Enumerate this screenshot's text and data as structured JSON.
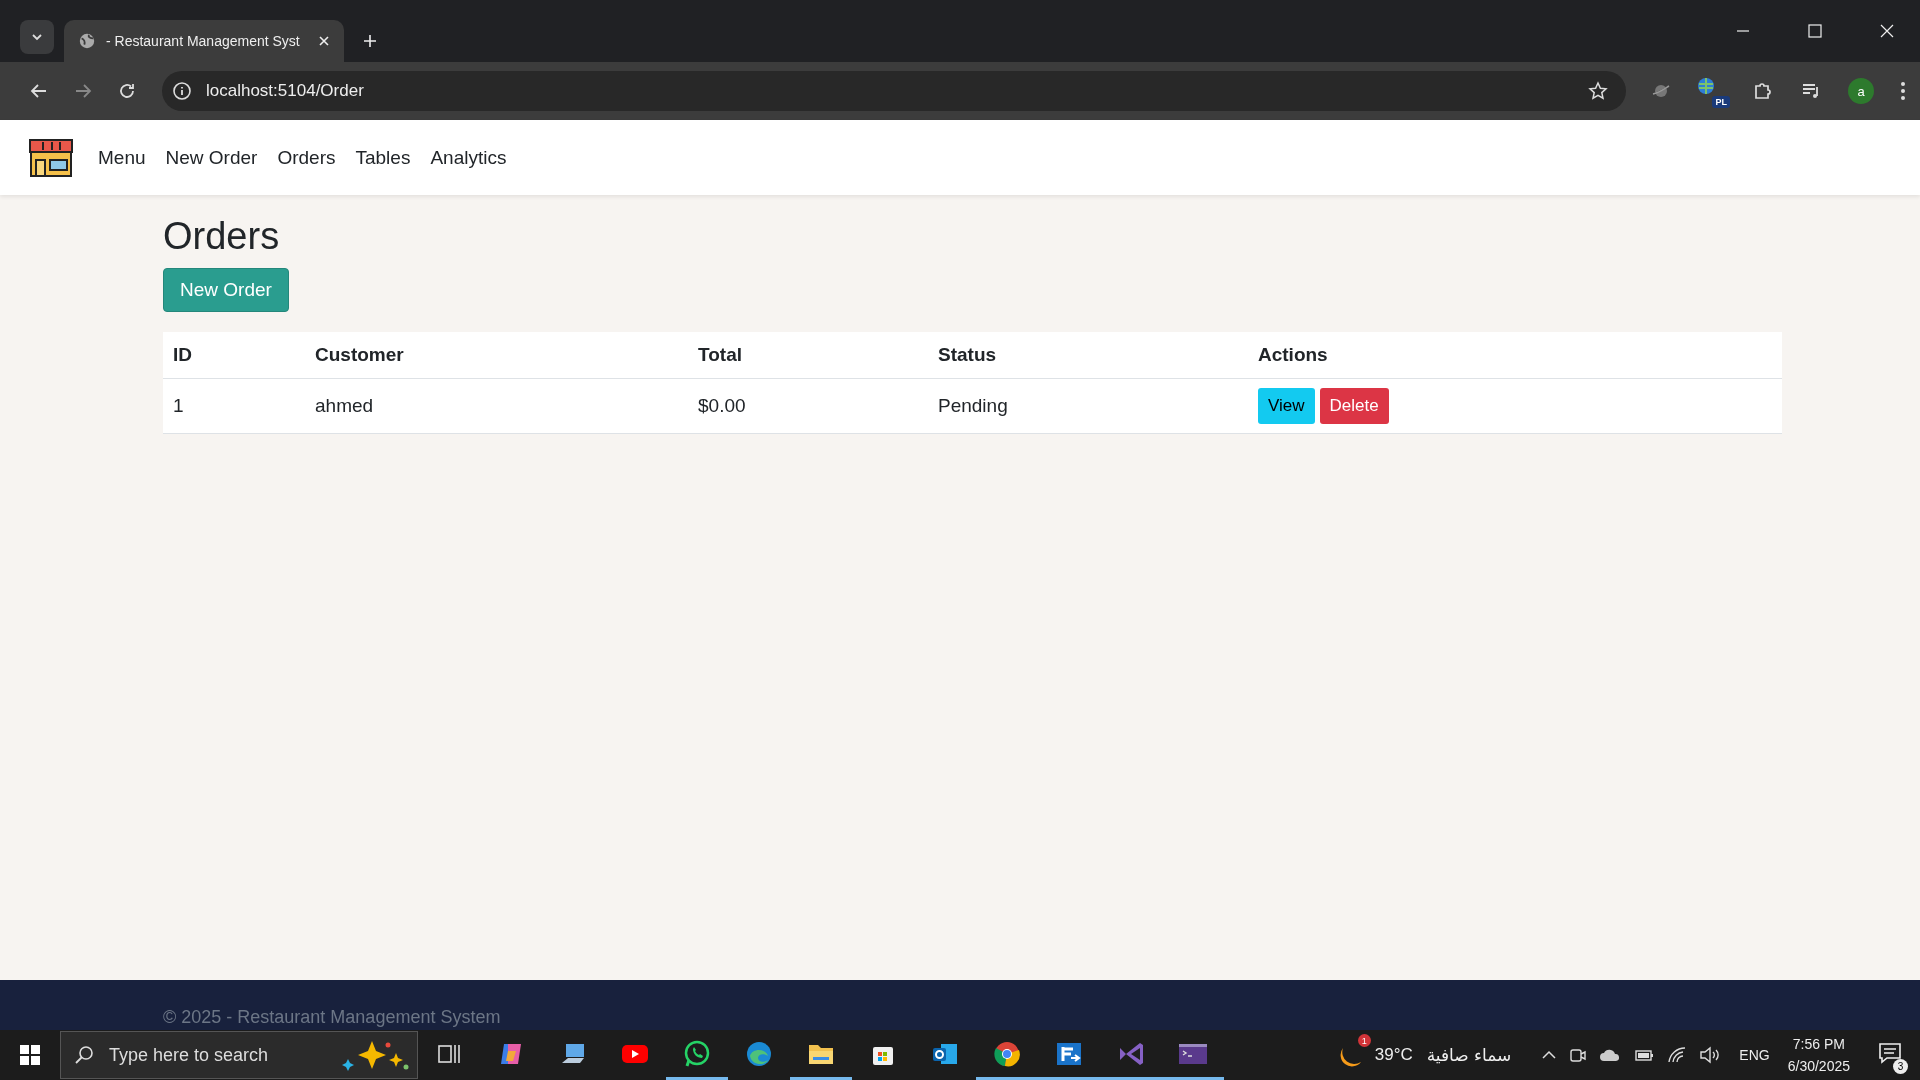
{
  "browser": {
    "tab_title": "- Restaurant Management Syst",
    "url": "localhost:5104/Order",
    "extension_badge": "PL",
    "profile_initial": "a"
  },
  "navbar": {
    "links": [
      "Menu",
      "New Order",
      "Orders",
      "Tables",
      "Analytics"
    ]
  },
  "page": {
    "title": "Orders",
    "new_button": "New Order"
  },
  "table": {
    "columns": [
      "ID",
      "Customer",
      "Total",
      "Status",
      "Actions"
    ],
    "rows": [
      {
        "id": "1",
        "customer": "ahmed",
        "total": "$0.00",
        "status": "Pending",
        "actions": [
          {
            "kind": "view",
            "label": "View"
          },
          {
            "kind": "delete",
            "label": "Delete"
          }
        ]
      }
    ]
  },
  "footer": {
    "text": "© 2025 - Restaurant Management System"
  },
  "taskbar": {
    "search_placeholder": "Type here to search",
    "apps": [
      {
        "kind": "taskview",
        "running": false
      },
      {
        "kind": "copilot",
        "running": false
      },
      {
        "kind": "computer",
        "running": false
      },
      {
        "kind": "youtube",
        "running": false
      },
      {
        "kind": "whatsapp",
        "running": true
      },
      {
        "kind": "edge",
        "running": false
      },
      {
        "kind": "folder",
        "running": true
      },
      {
        "kind": "store",
        "running": false
      },
      {
        "kind": "outlook",
        "running": false
      },
      {
        "kind": "chrome",
        "running": true
      },
      {
        "kind": "remote",
        "running": true
      },
      {
        "kind": "studio",
        "running": true
      },
      {
        "kind": "terminal",
        "running": true
      }
    ],
    "weather_badge": "1",
    "temperature": "39°C",
    "weather": "سماء صافية",
    "language": "ENG",
    "time": "7:56 PM",
    "date": "6/30/2025",
    "notifications": "3"
  }
}
